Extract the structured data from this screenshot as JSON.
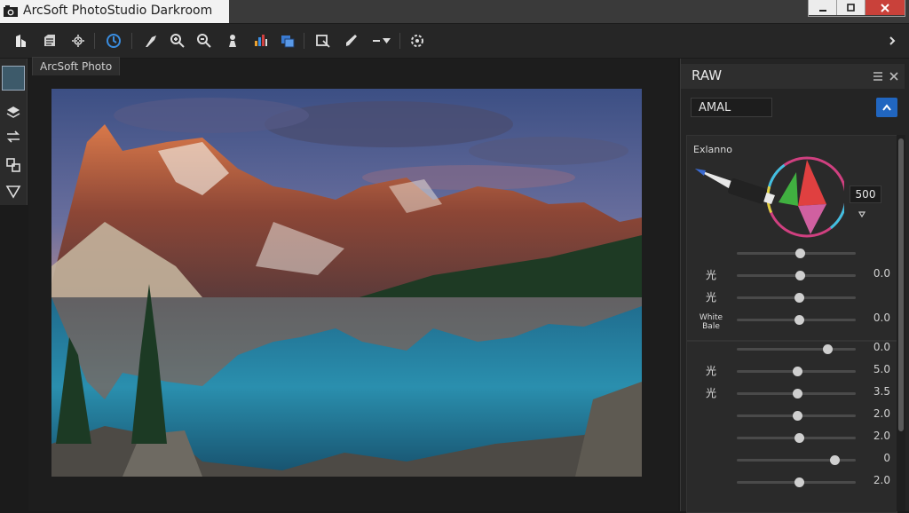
{
  "window": {
    "title": "ArcSoft PhotoStudio Darkroom",
    "buttons": {
      "minimize": "minimize-icon",
      "maximize": "maximize-icon",
      "close": "close-icon"
    }
  },
  "toolbar": {
    "icons": [
      "home-icon",
      "open-folder-icon",
      "crop-select-icon",
      "rotate-icon",
      "straighten-icon",
      "zoom-in-icon",
      "zoom-out-icon",
      "clone-icon",
      "histogram-icon",
      "layers-icon",
      "export-icon",
      "brush-icon",
      "more-dropdown-icon",
      "settings-icon",
      "expand-icon"
    ]
  },
  "canvas": {
    "tab_label": "ArcSoft Photo"
  },
  "left_tools": [
    "thumbnail",
    "stack-icon",
    "arrows-icon",
    "transform-icon",
    "filter-icon"
  ],
  "raw_panel": {
    "title": "RAW",
    "preset_value": "AMAL",
    "exposure_label": "Exlanno",
    "exposure_value": "500",
    "group1": [
      {
        "label": "",
        "value": "",
        "pos": 0.53
      },
      {
        "label": "光",
        "value": "0.0",
        "pos": 0.53
      },
      {
        "label": "光",
        "value": "",
        "pos": 0.52
      },
      {
        "label": "White Bale",
        "value": "0.0",
        "pos": 0.52
      }
    ],
    "group2": [
      {
        "label": "",
        "value": "0.0",
        "pos": 0.76
      },
      {
        "label": "光",
        "value": "5.0",
        "pos": 0.51
      },
      {
        "label": "光",
        "value": "3.5",
        "pos": 0.51
      },
      {
        "label": "",
        "value": "2.0",
        "pos": 0.51
      },
      {
        "label": "",
        "value": "2.0",
        "pos": 0.52
      },
      {
        "label": "",
        "value": "0",
        "pos": 0.82
      },
      {
        "label": "",
        "value": "2.0",
        "pos": 0.52
      }
    ]
  },
  "colors": {
    "accent": "#2166c0",
    "panel": "#242424",
    "titlebar": "#f2f2f2"
  }
}
